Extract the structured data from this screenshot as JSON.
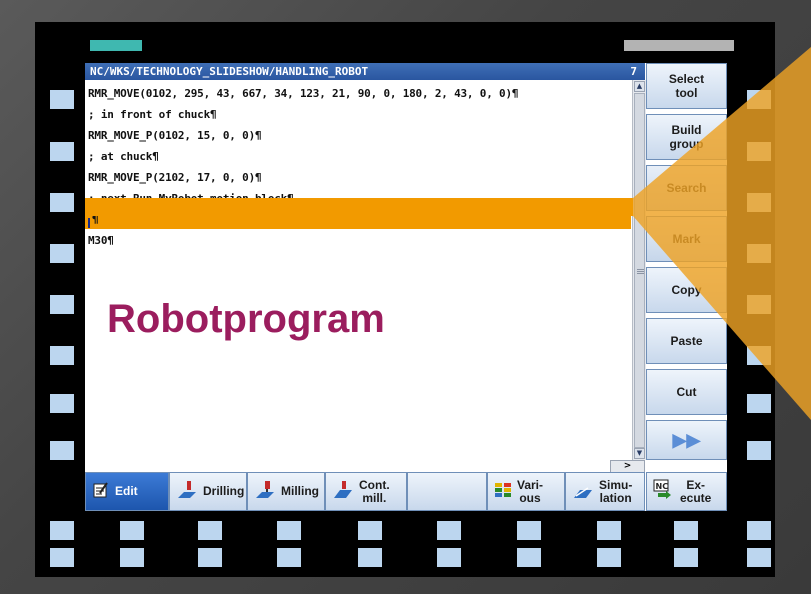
{
  "title_bar": {
    "path": "NC/WKS/TECHNOLOGY_SLIDESHOW/HANDLING_ROBOT",
    "count": "7"
  },
  "editor": {
    "lines": [
      "RMR_MOVE(0102, 295, 43, 667, 34, 123, 21, 90, 0, 180, 2, 43, 0, 0)¶",
      "; in front of chuck¶",
      "RMR_MOVE_P(0102, 15, 0, 0)¶",
      "; at chuck¶",
      "RMR_MOVE_P(2102, 17, 0, 0)¶",
      "; next Run MyRobot motion block¶",
      "¶",
      "M30¶"
    ]
  },
  "overlay_label": "Robotprogram",
  "vertical_softkeys": [
    {
      "label": "Select\ntool"
    },
    {
      "label": "Build\ngroup"
    },
    {
      "label": "Search"
    },
    {
      "label": "Mark"
    },
    {
      "label": "Copy"
    },
    {
      "label": "Paste"
    },
    {
      "label": "Cut"
    },
    {
      "label": "▶▶"
    }
  ],
  "horizontal_softkeys": [
    {
      "label": "Edit",
      "icon": "edit-icon"
    },
    {
      "label": "Drilling",
      "icon": "drilling-icon"
    },
    {
      "label": "Milling",
      "icon": "milling-icon"
    },
    {
      "label": "Cont.\nmill.",
      "icon": "contour-milling-icon"
    },
    {
      "label": "",
      "icon": ""
    },
    {
      "label": "Vari-\nous",
      "icon": "various-icon"
    },
    {
      "label": "Simu-\nlation",
      "icon": "simulation-icon"
    },
    {
      "label": "Ex-\necute",
      "icon": "nc-execute-icon"
    }
  ],
  "hscroll_label": ">",
  "colors": {
    "accent": "#f29a00",
    "label": "#9b1d5e",
    "titlebar": "#2a56a0"
  }
}
